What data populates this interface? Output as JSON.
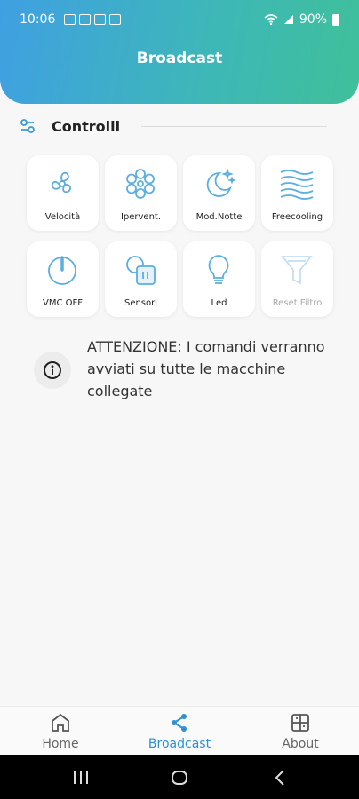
{
  "status": {
    "time": "10:06",
    "battery": "90%"
  },
  "header": {
    "title": "Broadcast"
  },
  "section": {
    "label": "Controlli"
  },
  "controls": [
    {
      "label": "Velocità",
      "icon": "fan-icon"
    },
    {
      "label": "Ipervent.",
      "icon": "snowflake-fan-icon"
    },
    {
      "label": "Mod.Notte",
      "icon": "moon-stars-icon"
    },
    {
      "label": "Freecooling",
      "icon": "waves-icon"
    },
    {
      "label": "VMC OFF",
      "icon": "power-icon"
    },
    {
      "label": "Sensori",
      "icon": "sensor-icon"
    },
    {
      "label": "Led",
      "icon": "bulb-icon"
    },
    {
      "label": "Reset Filtro",
      "icon": "filter-icon",
      "disabled": true
    }
  ],
  "notice": {
    "text": "ATTENZIONE: I comandi verranno avviati su tutte le macchine collegate"
  },
  "tabs": [
    {
      "label": "Home",
      "icon": "home-icon"
    },
    {
      "label": "Broadcast",
      "icon": "share-icon",
      "active": true
    },
    {
      "label": "About",
      "icon": "about-icon"
    }
  ],
  "colors": {
    "accent": "#2d8fd6",
    "icon": "#5aaee0",
    "gradient_start": "#3fa0e2",
    "gradient_end": "#3fc09a"
  }
}
